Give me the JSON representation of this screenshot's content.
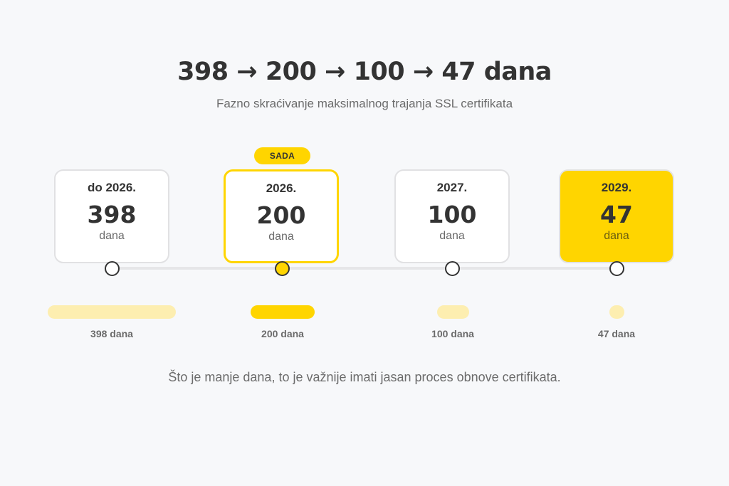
{
  "title": "398 → 200 → 100 → 47 dana",
  "subtitle": "Fazno skraćivanje maksimalnog trajanja SSL certifikata",
  "current_badge": "SADA",
  "colors": {
    "accent": "#ffd500",
    "accent_light": "#fdeeb0",
    "text": "#333333",
    "muted": "#6b6b6b"
  },
  "stages": [
    {
      "year": "do 2026.",
      "days": "398",
      "unit": "dana",
      "bar_label": "398 dana",
      "value": 398
    },
    {
      "year": "2026.",
      "days": "200",
      "unit": "dana",
      "bar_label": "200 dana",
      "value": 200
    },
    {
      "year": "2027.",
      "days": "100",
      "unit": "dana",
      "bar_label": "100 dana",
      "value": 100
    },
    {
      "year": "2029.",
      "days": "47",
      "unit": "dana",
      "bar_label": "47 dana",
      "value": 47
    }
  ],
  "note": "Što je manje dana, to je važnije imati jasan proces obnove certifikata."
}
